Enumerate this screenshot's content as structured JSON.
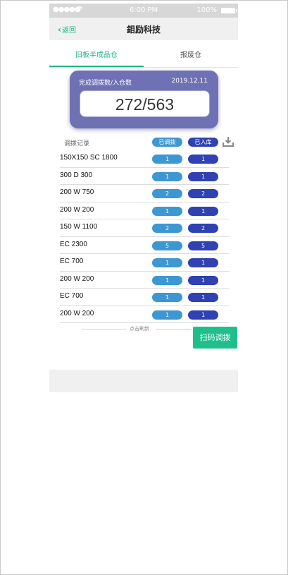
{
  "status_bar": {
    "signal": "●●●●●",
    "wifi": "wifi-icon",
    "time": "6:00 PM",
    "battery": "100%"
  },
  "nav": {
    "back_label": "返回",
    "title": "鉬励科技"
  },
  "tabs": [
    {
      "label": "旧板半成品仓",
      "active": true
    },
    {
      "label": "报废仓",
      "active": false
    }
  ],
  "summary": {
    "label": "完成调拨数/入仓数",
    "date": "2019.12.11",
    "count": "272/563"
  },
  "records": {
    "title": "调拨记录",
    "col_transferred": "已调拨",
    "col_stored": "已入库",
    "download_icon": "download-icon",
    "rows": [
      {
        "name": "150X150 SC 1800",
        "transferred": "1",
        "stored": "1"
      },
      {
        "name": "300 D 300",
        "transferred": "1",
        "stored": "1"
      },
      {
        "name": "200 W 750",
        "transferred": "2",
        "stored": "2"
      },
      {
        "name": "200 W 200",
        "transferred": "1",
        "stored": "1"
      },
      {
        "name": "150 W 1100",
        "transferred": "2",
        "stored": "2"
      },
      {
        "name": "EC 2300",
        "transferred": "5",
        "stored": "5"
      },
      {
        "name": "EC 700",
        "transferred": "1",
        "stored": "1"
      },
      {
        "name": "200 W 200",
        "transferred": "1",
        "stored": "1"
      },
      {
        "name": "EC 700",
        "transferred": "1",
        "stored": "1"
      },
      {
        "name": "200 W 200",
        "transferred": "1",
        "stored": "1"
      }
    ]
  },
  "refresh_label": "点击刷新",
  "scan_button": "扫码调拨",
  "colors": {
    "accent": "#1fb584",
    "summary_bg": "#6e71b3",
    "pill_light": "#3d97d3",
    "pill_dark": "#2f41b3"
  }
}
